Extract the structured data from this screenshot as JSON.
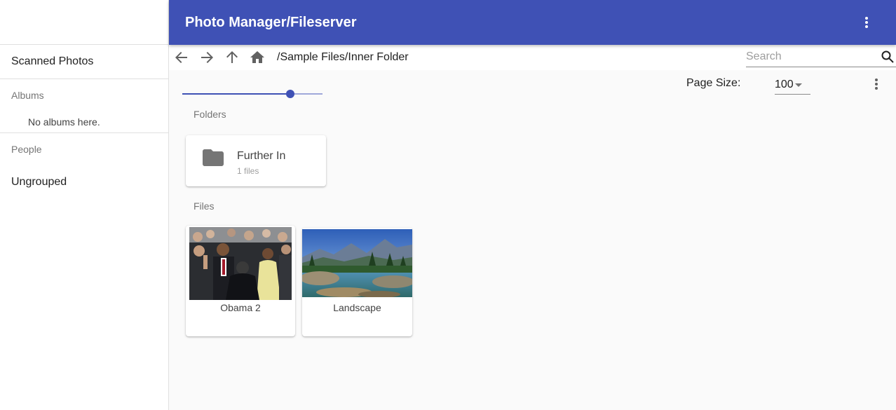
{
  "app": {
    "title": "Photo Manager/Fileserver"
  },
  "sidebar": {
    "top_item": "Scanned Photos",
    "albums_header": "Albums",
    "albums_empty": "No albums here.",
    "people_header": "People",
    "ungrouped": "Ungrouped"
  },
  "nav": {
    "path": "/Sample Files/Inner Folder",
    "search_placeholder": "Search"
  },
  "toolbar": {
    "zoom_fraction": 0.77,
    "page_size_label": "Page Size:",
    "page_size_value": "100"
  },
  "folders": {
    "label": "Folders",
    "items": [
      {
        "name": "Further In",
        "count": "1 files"
      }
    ]
  },
  "files": {
    "label": "Files",
    "items": [
      {
        "name": "Obama 2",
        "thumb_icon": "photo-people-icon"
      },
      {
        "name": "Landscape",
        "thumb_icon": "photo-landscape-icon"
      }
    ]
  },
  "colors": {
    "primary": "#3f51b5",
    "primary_light": "#9fa8da",
    "folder_icon": "#757575"
  }
}
